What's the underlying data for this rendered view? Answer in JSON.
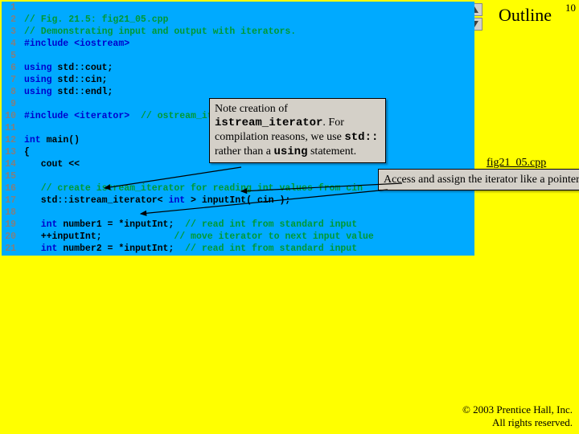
{
  "slide": {
    "outline_label": "Outline",
    "page_number": "10",
    "file_label": "fig21_05.cpp",
    "copyright_line1": "© 2003 Prentice Hall, Inc.",
    "copyright_line2": "All rights reserved."
  },
  "code": {
    "lines": [
      "1",
      "2",
      "3",
      "4",
      "5",
      "6",
      "7",
      "8",
      "9",
      "10",
      "11",
      "12",
      "13",
      "14",
      "15",
      "16",
      "17",
      "18",
      "19",
      "20",
      "21"
    ],
    "l1": "// Fig. 21.5: fig21_05.cpp",
    "l2": "// Demonstrating input and output with iterators.",
    "l3a": "#include ",
    "l3b": "<iostream>",
    "l5a": "using ",
    "l5b": "std::cout;",
    "l6a": "using ",
    "l6b": "std::cin;",
    "l7a": "using ",
    "l7b": "std::endl;",
    "l9a": "#include ",
    "l9b": "<iterator>",
    "l9c": "  // ostream_iterator and istream_iterator",
    "l11a": "int",
    "l11b": " main()",
    "l12": "{",
    "l13": "   cout << ",
    "l15": "   // create istream_iterator for reading int values from cin",
    "l16a": "   std::istream_iterator< ",
    "l16b": "int",
    "l16c": " > inputInt( cin );",
    "l18a": "   int",
    "l18b": " number1 = *inputInt;  ",
    "l18c": "// read int from standard input",
    "l19a": "   ++inputInt;             ",
    "l19b": "// move iterator to next input value",
    "l20a": "   int",
    "l20b": " number2 = *inputInt;  ",
    "l20c": "// read int from standard input"
  },
  "callouts": {
    "c1_a": "Note creation of ",
    "c1_b": "istream_iterator",
    "c1_c": ". For compilation reasons, we use ",
    "c1_d": "std::",
    "c1_e": " rather than a ",
    "c1_f": "using",
    "c1_g": " statement.",
    "c2": "Access and assign the iterator like a pointer."
  }
}
